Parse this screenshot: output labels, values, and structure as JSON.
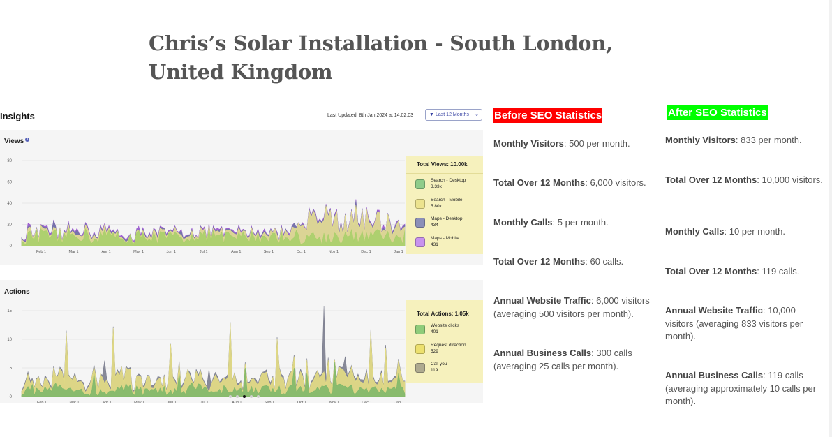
{
  "page": {
    "title": "Chris’s Solar Installation - South London, United Kingdom"
  },
  "insights": {
    "title": "Insights",
    "last_updated": "Last Updated: 8th Jan 2024 at 14:02:03",
    "filter_label": "Last 12 Months",
    "carousel": {
      "count": 5,
      "active_index": 2
    }
  },
  "chart_data": [
    {
      "type": "area",
      "title": "Views",
      "ylim": [
        0,
        80
      ],
      "yticks": [
        "0",
        "20",
        "40",
        "60",
        "80"
      ],
      "x_ticks": [
        "Feb 1",
        "Mar 1",
        "Apr 1",
        "May 1",
        "Jun 1",
        "Jul 1",
        "Aug 1",
        "Sep 1",
        "Oct 1",
        "Nov 1",
        "Dec 1",
        "Jan 1"
      ],
      "total_label": "Total Views: 10.00k",
      "grid": true,
      "legend_position": "right",
      "series": [
        {
          "name": "Search - Desktop",
          "total": "3.33k",
          "color": "#a9cf6a",
          "swatch": "#8fcc8a",
          "profile": [
            9,
            9,
            9,
            10,
            10,
            10,
            9,
            9,
            9,
            8,
            9,
            10,
            9,
            8,
            9,
            9,
            9,
            9,
            8,
            9,
            10,
            10,
            9,
            9
          ],
          "spikes": [
            [
              26,
              13
            ],
            [
              58,
              16
            ],
            [
              150,
              14
            ],
            [
              252,
              11
            ],
            [
              305,
              12
            ],
            [
              440,
              10
            ],
            [
              470,
              11
            ]
          ]
        },
        {
          "name": "Search - Mobile",
          "total": "5.80k",
          "color": "#e6df92",
          "swatch": "#ece38e",
          "profile": [
            3,
            3,
            3,
            3,
            3,
            3,
            2,
            2,
            3,
            3,
            3,
            3,
            3,
            3,
            3,
            3,
            6,
            12,
            18,
            22,
            16,
            13,
            12,
            12
          ],
          "spikes": [
            [
              442,
              26
            ],
            [
              468,
              36
            ],
            [
              472,
              30
            ],
            [
              506,
              12
            ],
            [
              520,
              20
            ],
            [
              538,
              8
            ],
            [
              560,
              12
            ]
          ]
        },
        {
          "name": "Maps - Desktop",
          "total": "434",
          "color": "#7276a6",
          "swatch": "#8b8fb8",
          "profile": [
            1,
            1,
            1,
            1,
            1,
            1,
            1,
            1,
            1,
            1,
            1,
            1,
            1,
            1,
            1,
            1,
            1,
            1,
            1,
            1,
            1,
            1,
            1,
            1
          ],
          "spikes": [
            [
              78,
              6
            ],
            [
              110,
              5
            ],
            [
              260,
              4
            ],
            [
              420,
              4
            ],
            [
              510,
              4
            ]
          ]
        },
        {
          "name": "Maps - Mobile",
          "total": "431",
          "color": "#9a56cf",
          "swatch": "#c892ee",
          "profile": [
            1,
            1,
            1,
            1,
            1,
            1,
            1,
            1,
            1,
            1,
            1,
            1,
            1,
            1,
            1,
            1,
            1,
            1,
            1,
            1,
            1,
            1,
            1,
            1
          ],
          "spikes": [
            [
              40,
              3
            ],
            [
              200,
              3
            ],
            [
              380,
              2
            ],
            [
              550,
              3
            ]
          ]
        }
      ]
    },
    {
      "type": "area",
      "title": "Actions",
      "ylim": [
        0,
        15
      ],
      "yticks": [
        "0",
        "5",
        "10",
        "15"
      ],
      "x_ticks": [
        "Feb 1",
        "Mar 1",
        "Apr 1",
        "May 1",
        "Jun 1",
        "Jul 1",
        "Aug 1",
        "Sep 1",
        "Oct 1",
        "Nov 1",
        "Dec 1",
        "Jan 1"
      ],
      "total_label": "Total Actions: 1.05k",
      "grid": true,
      "legend_position": "right",
      "series": [
        {
          "name": "Website clicks",
          "total": "401",
          "color": "#7fb86a",
          "swatch": "#8fcc7a",
          "profile": [
            1,
            1.5,
            1.5,
            1.2,
            1,
            1.2,
            1.5,
            1.3,
            1,
            1.2,
            1.5,
            1.4,
            1.2,
            1,
            1.2,
            1.5,
            1.3,
            1.1,
            1.2,
            1.4,
            1.3,
            1.1,
            1,
            1.2
          ],
          "spikes": [
            [
              26,
              5
            ],
            [
              134,
              4
            ],
            [
              256,
              4
            ],
            [
              350,
              5
            ],
            [
              421,
              5
            ],
            [
              440,
              4
            ],
            [
              480,
              6
            ],
            [
              570,
              4
            ]
          ]
        },
        {
          "name": "Request direction",
          "total": "529",
          "color": "#e5de84",
          "swatch": "#ece06e",
          "profile": [
            1.5,
            2,
            2,
            1.8,
            1.6,
            1.8,
            2,
            1.9,
            1.6,
            1.8,
            2,
            2,
            1.8,
            1.6,
            1.8,
            2,
            1.9,
            1.7,
            1.8,
            2,
            1.9,
            1.7,
            1.6,
            1.8
          ],
          "spikes": [
            [
              95,
              10
            ],
            [
              163,
              11
            ],
            [
              244,
              8
            ],
            [
              330,
              12
            ],
            [
              398,
              9
            ],
            [
              470,
              5
            ],
            [
              530,
              10
            ],
            [
              553,
              8
            ]
          ]
        },
        {
          "name": "Call you",
          "total": "119",
          "color": "#7b7d8e",
          "swatch": "#aeaa90",
          "profile": [
            0.3,
            0.3,
            0.3,
            0.3,
            0.3,
            0.3,
            0.3,
            0.3,
            0.3,
            0.3,
            0.3,
            0.3,
            0.3,
            0.3,
            0.3,
            0.3,
            0.3,
            0.3,
            0.3,
            0.3,
            0.3,
            0.3,
            0.3,
            0.3
          ],
          "spikes": [
            [
              464,
              14
            ],
            [
              150,
              4
            ],
            [
              300,
              4
            ],
            [
              495,
              3
            ]
          ]
        }
      ]
    }
  ],
  "stats": {
    "before": {
      "heading": "Before SEO Statistics",
      "items": [
        {
          "label": "Monthly Visitors",
          "text": ": 500 per month."
        },
        {
          "label": "Total Over 12 Months",
          "text": ": 6,000 visitors."
        },
        {
          "label": "Monthly Calls",
          "text": ": 5 per month."
        },
        {
          "label": "Total Over 12 Months",
          "text": ": 60 calls."
        },
        {
          "label": "Annual Website Traffic",
          "text": ": 6,000 visitors (averaging 500 visitors per month)."
        },
        {
          "label": "Annual Business Calls",
          "text": ": 300 calls (averaging 25 calls per month)."
        }
      ]
    },
    "after": {
      "heading": "After SEO Statistics",
      "items": [
        {
          "label": "Monthly Visitors",
          "text": ": 833 per month."
        },
        {
          "label": "Total Over 12 Months",
          "text": ": 10,000 visitors."
        },
        {
          "label": "Monthly Calls",
          "text": ": 10 per month."
        },
        {
          "label": "Total Over 12 Months",
          "text": ": 119 calls."
        },
        {
          "label": "Annual Website Traffic",
          "text": ": 10,000 visitors (averaging 833 visitors per month)."
        },
        {
          "label": "Annual Business Calls",
          "text": ": 119 calls (averaging approximately 10 calls per month)."
        }
      ]
    }
  },
  "colors": {
    "title": "#555555",
    "before_heading_bg": "#ff0000",
    "after_heading_bg": "#00ff00",
    "legend_bg": "#f6f1bd",
    "card_bg": "#f5f5f5"
  }
}
